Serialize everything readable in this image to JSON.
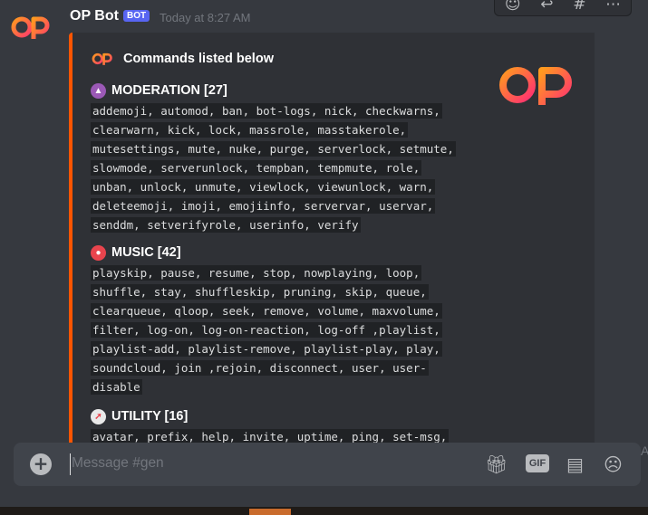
{
  "message": {
    "username": "OP Bot",
    "badge": "BOT",
    "timestamp": "Today at 8:27 AM"
  },
  "embed": {
    "accent_color": "#ff5500",
    "author": "Commands listed below",
    "fields": [
      {
        "icon": "bell-icon",
        "icon_color": "#9b59b6",
        "name": "MODERATION [27]",
        "value": "addemoji, automod, ban, bot-logs, nick, checkwarns, clearwarn, kick, lock, massrole, masstakerole, mutesettings, mute, nuke, purge, serverlock, setmute, slowmode, serverunlock, tempban, tempmute, role, unban, unlock, unmute, viewlock, viewunlock, warn, deleteemoji, imoji, emojiinfo, servervar, uservar, senddm, setverifyrole, userinfo, verify"
      },
      {
        "icon": "flame-icon",
        "icon_color": "#e8444d",
        "name": "MUSIC [42]",
        "value": "playskip, pause, resume, stop, nowplaying, loop, shuffle, stay, shuffleskip, pruning, skip, queue, clearqueue, qloop, seek, remove, volume, maxvolume, filter, log-on, log-on-reaction, log-off ,playlist, playlist-add, playlist-remove, playlist-play, play, soundcloud, join ,rejoin, disconnect, user, user-disable"
      },
      {
        "icon": "compass-icon",
        "icon_color": "#e9e9e9",
        "name": "UTILITY [16]",
        "value": "avatar, prefix, help, invite, uptime, ping, set-msg,"
      }
    ]
  },
  "composer": {
    "placeholder": "Message #gen",
    "gif_label": "GIF"
  },
  "edge_text": "A"
}
